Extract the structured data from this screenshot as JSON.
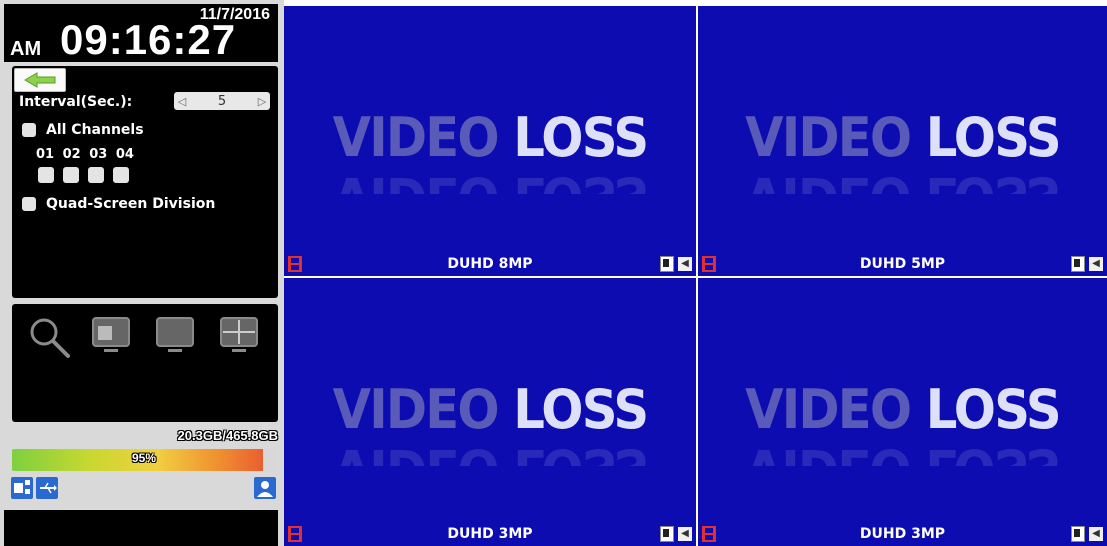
{
  "clock": {
    "date": "11/7/2016",
    "ampm": "AM",
    "time": "09:16:27"
  },
  "settings": {
    "interval_label": "Interval(Sec.):",
    "interval_value": "5",
    "all_channels_label": "All Channels",
    "channels": [
      "01",
      "02",
      "03",
      "04"
    ],
    "quad_label": "Quad-Screen Division"
  },
  "toolbar": {
    "icons": [
      "search-icon",
      "pip-view-icon",
      "single-view-icon",
      "quad-view-icon"
    ]
  },
  "storage": {
    "text": "20.3GB/465.8GB",
    "percent_label": "95%",
    "percent": 0.95
  },
  "bottom_icons": [
    "network-icon",
    "usb-icon",
    "user-icon"
  ],
  "cameras": [
    {
      "video_loss_1": "VIDEO",
      "video_loss_2": "LOSS",
      "label": "DUHD 8MP"
    },
    {
      "video_loss_1": "VIDEO",
      "video_loss_2": "LOSS",
      "label": "DUHD 5MP"
    },
    {
      "video_loss_1": "VIDEO",
      "video_loss_2": "LOSS",
      "label": "DUHD 3MP"
    },
    {
      "video_loss_1": "VIDEO",
      "video_loss_2": "LOSS",
      "label": "DUHD 3MP"
    }
  ],
  "colors": {
    "video_bg": "#0c0cb0",
    "panel_bg": "#000000",
    "accent_green": "#7ed040",
    "rec_red": "#e03030"
  }
}
